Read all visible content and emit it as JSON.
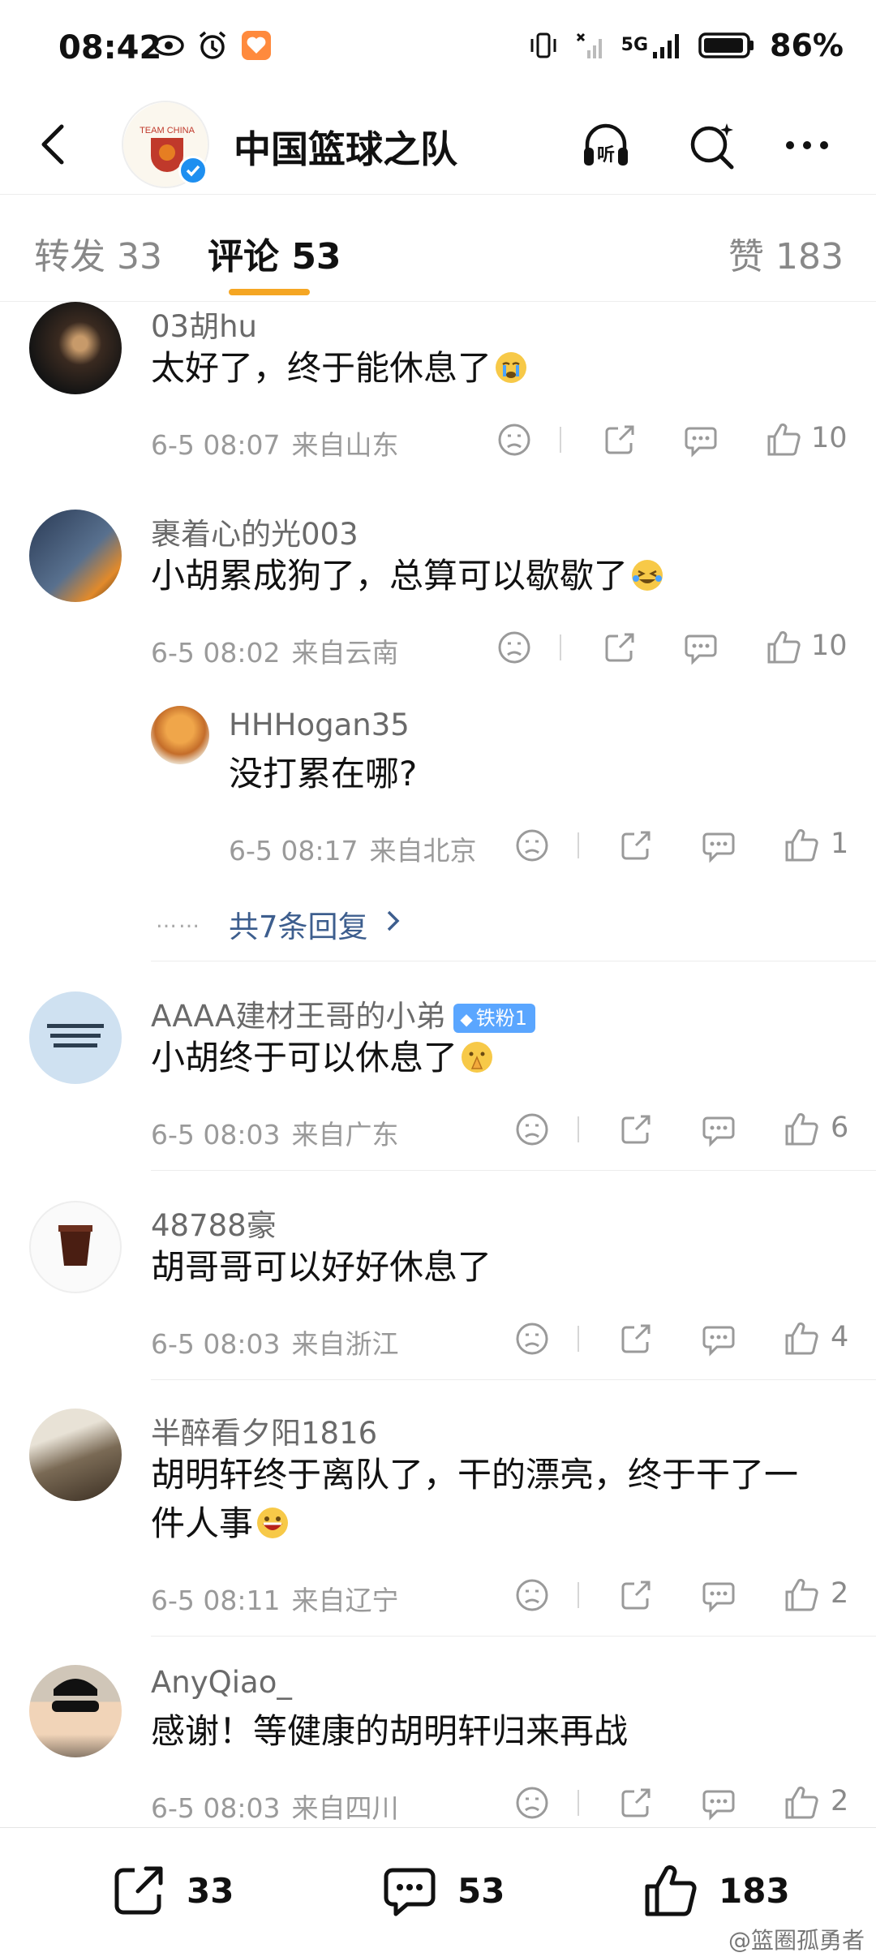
{
  "status_bar": {
    "time": "08:42",
    "network": "5G",
    "battery": "86%"
  },
  "header": {
    "title": "中国篮球之队",
    "avatar_text": "TEAM CHINA"
  },
  "tabs": [
    {
      "label": "转发 33"
    },
    {
      "label": "评论 53"
    },
    {
      "label": "赞 183"
    }
  ],
  "comments": [
    {
      "name": "03胡hu",
      "text": "太好了，终于能休息了",
      "emoji": "crying-emoji",
      "time": "6-5 08:07",
      "location": "来自山东",
      "likes": "10"
    },
    {
      "name": "裹着心的光003",
      "text": "小胡累成狗了，总算可以歇歇了",
      "emoji": "laugh-cry-emoji",
      "time": "6-5 08:02",
      "location": "来自云南",
      "likes": "10"
    },
    {
      "name": "AAAA建材王哥的小弟",
      "badge": "铁粉1",
      "text": "小胡终于可以休息了",
      "emoji": "pray-emoji",
      "time": "6-5 08:03",
      "location": "来自广东",
      "likes": "6"
    },
    {
      "name": "48788豪",
      "text": "胡哥哥可以好好休息了",
      "time": "6-5 08:03",
      "location": "来自浙江",
      "likes": "4"
    },
    {
      "name": "半醉看夕阳1816",
      "text_line1": "胡明轩终于离队了，干的漂亮，终于干了一",
      "text_line2": "件人事",
      "emoji": "grin-emoji",
      "time": "6-5 08:11",
      "location": "来自辽宁",
      "likes": "2"
    },
    {
      "name": "AnyQiao_",
      "text": "感谢！等健康的胡明轩归来再战",
      "time": "6-5 08:03",
      "location": "来自四川",
      "likes": "2"
    }
  ],
  "reply": {
    "name": "HHHogan35",
    "text": "没打累在哪?",
    "time": "6-5 08:17",
    "location": "来自北京",
    "likes": "1",
    "more": "共7条回复",
    "dots": "……"
  },
  "bottom_bar": {
    "repost": "33",
    "comment": "53",
    "like": "183"
  },
  "watermark": "@篮圈孤勇者",
  "colors": {
    "accent": "#f5a623",
    "link": "#3d5e8e",
    "verify": "#1e8ff0",
    "badge": "#5aa6ff"
  }
}
